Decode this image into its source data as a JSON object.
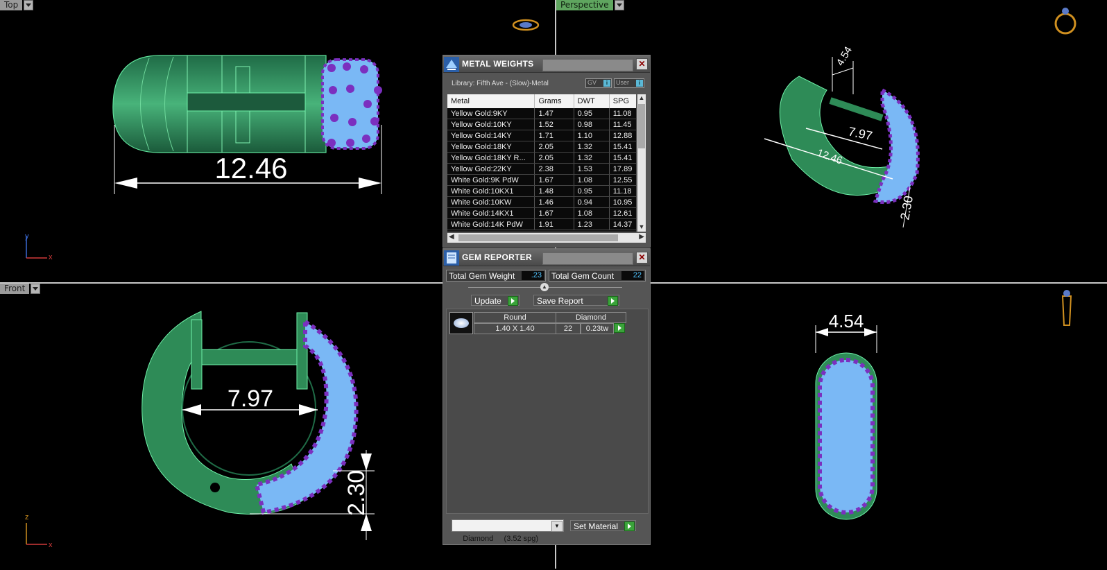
{
  "viewports": {
    "top": {
      "label": "Top"
    },
    "perspective": {
      "label": "Perspective"
    },
    "front": {
      "label": "Front"
    }
  },
  "dimensions": {
    "top_length": "12.46",
    "front_inner": "7.97",
    "front_thickness": "2.30",
    "side_width": "4.54",
    "persp_width": "4.54",
    "persp_inner": "7.97",
    "persp_length": "12.46",
    "persp_thickness": "2.30"
  },
  "axes": {
    "y": "y",
    "x": "x",
    "z": "z"
  },
  "metal_weights": {
    "title": "METAL WEIGHTS",
    "library": "Library: Fifth Ave - (Slow)-Metal",
    "toggle_gv": "GV",
    "toggle_user": "User",
    "columns": [
      "Metal",
      "Grams",
      "DWT",
      "SPG"
    ],
    "rows": [
      [
        "Yellow Gold:9KY",
        "1.47",
        "0.95",
        "11.08"
      ],
      [
        "Yellow Gold:10KY",
        "1.52",
        "0.98",
        "11.45"
      ],
      [
        "Yellow Gold:14KY",
        "1.71",
        "1.10",
        "12.88"
      ],
      [
        "Yellow Gold:18KY",
        "2.05",
        "1.32",
        "15.41"
      ],
      [
        "Yellow Gold:18KY R...",
        "2.05",
        "1.32",
        "15.41"
      ],
      [
        "Yellow Gold:22KY",
        "2.38",
        "1.53",
        "17.89"
      ],
      [
        "White Gold:9K PdW",
        "1.67",
        "1.08",
        "12.55"
      ],
      [
        "White Gold:10KX1",
        "1.48",
        "0.95",
        "11.18"
      ],
      [
        "White Gold:10KW",
        "1.46",
        "0.94",
        "10.95"
      ],
      [
        "White Gold:14KX1",
        "1.67",
        "1.08",
        "12.61"
      ],
      [
        "White Gold:14K PdW",
        "1.91",
        "1.23",
        "14.37"
      ]
    ]
  },
  "gem_reporter": {
    "title": "GEM REPORTER",
    "total_weight_label": "Total Gem Weight",
    "total_weight": ".23",
    "total_count_label": "Total Gem Count",
    "total_count": "22",
    "update_label": "Update",
    "save_label": "Save Report",
    "gem": {
      "shape": "Round",
      "type": "Diamond",
      "size": "1.40 X 1.40",
      "count": "22",
      "weight": "0.23tw"
    },
    "material_select": "Diamond     (3.52 spg)",
    "set_material_label": "Set Material"
  },
  "colors": {
    "metal": "#2e8b57",
    "gem": "#7ab8f5",
    "prong": "#7b2fbf",
    "accent": "#3aa33a"
  }
}
